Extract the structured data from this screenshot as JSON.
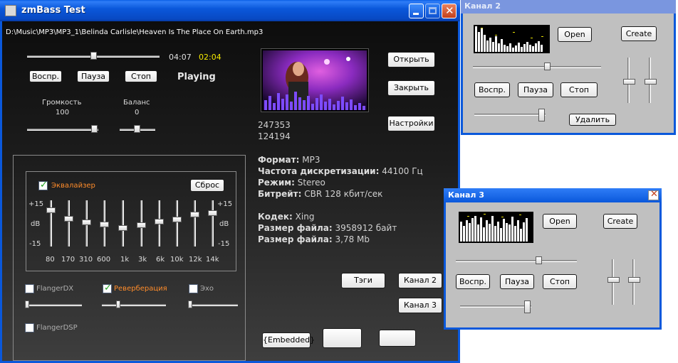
{
  "main": {
    "title": "zmBass Test",
    "filepath": "D:\\Music\\MP3\\MP3_1\\Belinda Carlisle\\Heaven Is The Place On Earth.mp3",
    "time_total": "04:07",
    "time_current": "02:04",
    "position_fraction": 0.5,
    "status": "Playing",
    "buttons": {
      "play": "Воспр.",
      "pause": "Пауза",
      "stop": "Стоп",
      "open": "Открыть",
      "close": "Закрыть",
      "settings": "Настройки",
      "tags": "Тэги",
      "channel2": "Канал 2",
      "channel3": "Канал 3",
      "embedded": "{Embedded}"
    },
    "volume": {
      "label": "Громкость",
      "value": "100"
    },
    "balance": {
      "label": "Баланс",
      "value": "0"
    },
    "counters": [
      "247353",
      "124194"
    ],
    "info": {
      "format_label": "Формат:",
      "format_value": "MP3",
      "rate_label": "Частота дискретизации:",
      "rate_value": "44100 Гц",
      "mode_label": "Режим:",
      "mode_value": "Stereo",
      "bitrate_label": "Битрейт:",
      "bitrate_value": "CBR 128 кбит/сек",
      "codec_label": "Кодек:",
      "codec_value": "Xing",
      "size_label": "Размер файла:",
      "size_value": "3958912 байт",
      "size2_label": "Размер файла:",
      "size2_value": "3,78 Mb"
    },
    "equalizer": {
      "label": "Эквалайзер",
      "enabled": true,
      "reset": "Сброс",
      "top_db": "+15",
      "mid_db": "dB",
      "bottom_db": "-15",
      "bands": [
        "80",
        "170",
        "310",
        "600",
        "1k",
        "3k",
        "6k",
        "10k",
        "12k",
        "14k"
      ]
    },
    "effects": {
      "flanger": {
        "label": "FlangerDX",
        "enabled": false
      },
      "reverb": {
        "label": "Реверберация",
        "enabled": true
      },
      "echo": {
        "label": "Эхо",
        "enabled": false
      },
      "flanger_dsp": {
        "label": "FlangerDSP",
        "enabled": false
      }
    }
  },
  "channel2": {
    "title": "Канал 2",
    "open": "Open",
    "create": "Create",
    "play": "Воспр.",
    "pause": "Пауза",
    "stop": "Стоп",
    "delete": "Удалить"
  },
  "channel3": {
    "title": "Канал 3",
    "open": "Open",
    "create": "Create",
    "play": "Воспр.",
    "pause": "Пауза",
    "stop": "Стоп"
  },
  "colors": {
    "accent_orange": "#ff8c2a",
    "time_yellow": "#f4e800",
    "xp_blue": "#0a58db"
  }
}
